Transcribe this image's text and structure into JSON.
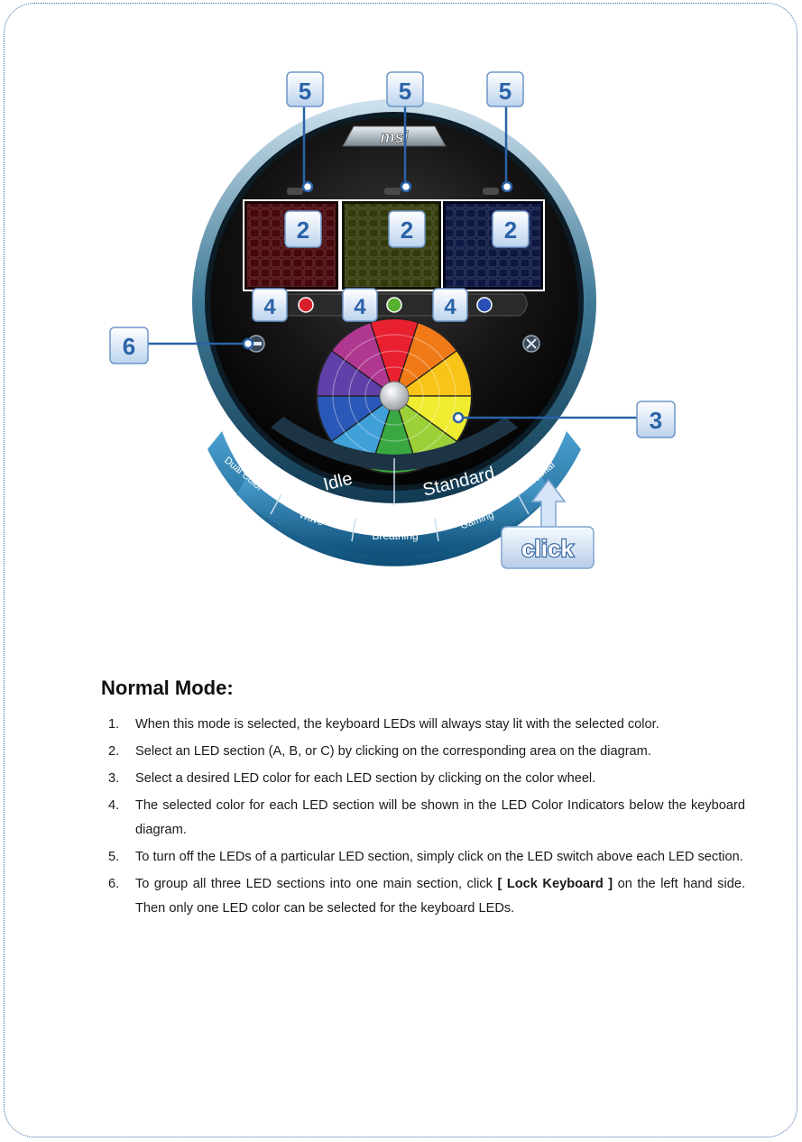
{
  "diagram": {
    "logo": "msi",
    "modes": {
      "idle": "Idle",
      "standard": "Standard",
      "dual_color": "Dual Color",
      "wave": "Wave",
      "breathing": "Breathing",
      "gaming": "Gaming",
      "normal": "Normal"
    },
    "callouts": {
      "led_switch": "5",
      "led_section": "2",
      "color_indicator": "4",
      "lock_keyboard": "6",
      "color_wheel": "3"
    },
    "click_label": "click",
    "led_section_colors": [
      "#c0141c",
      "#a0b020",
      "#2040a0"
    ],
    "indicator_colors": [
      "#d8202a",
      "#58b030",
      "#2a50b8"
    ],
    "wheel_colors": [
      "#e82030",
      "#f07a18",
      "#f8c418",
      "#f0ec30",
      "#9cd038",
      "#3aa840",
      "#40a0d8",
      "#2a58b8",
      "#6040a8",
      "#b03890"
    ],
    "accent_color": "#2a63a8"
  },
  "heading": "Normal Mode:",
  "steps": [
    {
      "num": "1.",
      "text": "When this mode is selected, the keyboard LEDs will always stay lit with the selected color."
    },
    {
      "num": "2.",
      "text": "Select an LED section (A, B, or C) by clicking on the corresponding area on the diagram."
    },
    {
      "num": "3.",
      "text": "Select a desired LED color for each LED section by clicking on the color wheel."
    },
    {
      "num": "4.",
      "text": "The selected color for each LED section will be shown in the LED Color Indicators below the keyboard diagram."
    },
    {
      "num": "5.",
      "text": "To turn off the LEDs of a particular LED section, simply click on the LED switch above each LED section."
    },
    {
      "num": "6.",
      "text_before": "To group all three LED sections into one main section, click ",
      "bold": "[ Lock Keyboard ]",
      "text_after": " on the left hand side. Then only one LED color can be selected for the keyboard LEDs."
    }
  ]
}
